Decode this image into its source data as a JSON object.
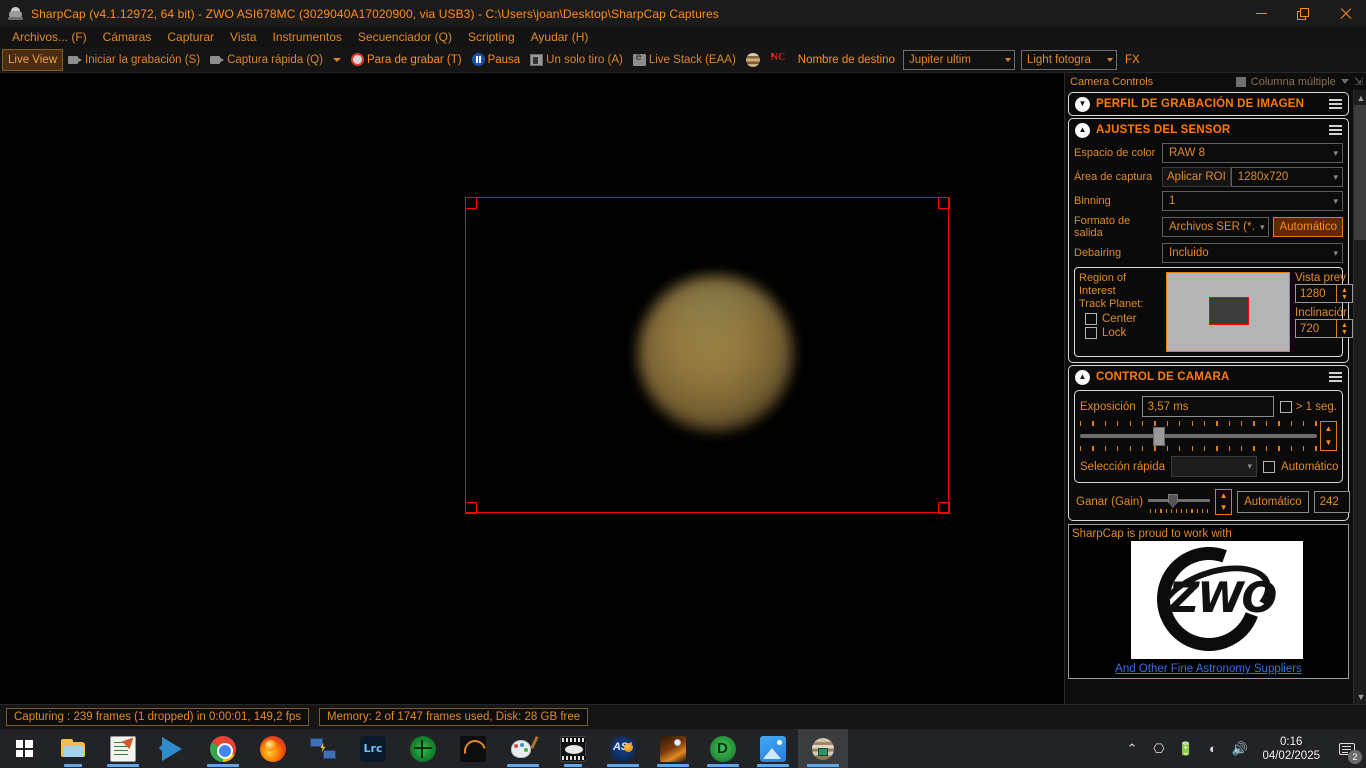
{
  "window": {
    "title": "SharpCap (v4.1.12972, 64 bit) - ZWO ASI678MC (3029040A17020900, via USB3) - C:\\Users\\joan\\Desktop\\SharpCap Captures",
    "minimize": "—",
    "maximize": "❐",
    "close": "✕"
  },
  "menu": {
    "items": [
      {
        "label": "Archivos... (F)"
      },
      {
        "label": "Cámaras"
      },
      {
        "label": "Capturar"
      },
      {
        "label": "Vista"
      },
      {
        "label": "Instrumentos"
      },
      {
        "label": "Secuenciador (Q)"
      },
      {
        "label": "Scripting"
      },
      {
        "label": "Ayudar (H)"
      }
    ]
  },
  "toolbar": {
    "live_view": "Live View",
    "start_recording": "Iniciar la grabación (S)",
    "quick_capture": "Captura rápida (Q)",
    "stop_recording": "Para de grabar (T)",
    "pause": "Pausa",
    "single_shot": "Un solo tiro (A)",
    "live_stack": "Live Stack (EAA)",
    "target_name_label": "Nombre de destino",
    "target_name_value": "Jupiter ultim",
    "light_frame_value": "Light fotogra",
    "fx": "FX"
  },
  "panel": {
    "header": {
      "title": "Camera Controls",
      "multi_column": "Columna múltiple",
      "pin": "⇲"
    },
    "capture_profile": {
      "title": "PERFIL DE GRABACIÓN DE IMAGEN",
      "collapsed": true
    },
    "sensor_settings": {
      "title": "AJUSTES DEL SENSOR",
      "rows": [
        {
          "label": "Espacio de color",
          "value": "RAW 8",
          "type": "combo"
        },
        {
          "label": "Área de captura",
          "button": "Aplicar ROI",
          "value": "1280x720",
          "type": "combo-button"
        },
        {
          "label": "Binning",
          "value": "1",
          "type": "combo"
        },
        {
          "label": "Formato de salida",
          "value": "Archivos SER (*…",
          "button": "Automático",
          "type": "combo-auto"
        },
        {
          "label": "Debairing",
          "value": "Incluido",
          "type": "combo"
        }
      ],
      "roi": {
        "title": "Region of Interest",
        "track_planet_label": "Track Planet:",
        "center_label": "Center",
        "center_checked": false,
        "lock_label": "Lock",
        "lock_checked": false,
        "preview_label": "Vista prev",
        "preview_value": "1280",
        "tilt_label": "Inclinaciór",
        "tilt_value": "720"
      }
    },
    "camera_control": {
      "title": "CONTROL DE CAMARA",
      "exposure_label": "Exposición",
      "exposure_value": "3,57 ms",
      "over_one_sec_label": "> 1 seg.",
      "over_one_sec_checked": false,
      "exposure_slider_percent": 31,
      "quick_select_label": "Selección rápida",
      "quick_select_value": "",
      "quick_auto_label": "Automático",
      "quick_auto_checked": false,
      "gain_label": "Ganar (Gain)",
      "gain_auto_label": "Automático",
      "gain_value": "242",
      "gain_slider_percent": 32
    },
    "sponsor": {
      "caption": "SharpCap is proud to work with",
      "logo_text": "ZWO",
      "link": "And Other Fine Astronomy Suppliers"
    }
  },
  "status": {
    "capture": "Capturing : 239 frames (1 dropped) in 0:00:01, 149,2 fps",
    "memory": "Memory: 2 of 1747 frames used, Disk: 28 GB free"
  },
  "taskbar": {
    "items": [
      {
        "name": "start",
        "icon": "windows-icon",
        "active": false
      },
      {
        "name": "file-explorer",
        "icon": "folder-icon",
        "active": false,
        "running": true
      },
      {
        "name": "notepad",
        "icon": "notepad-icon",
        "active": false,
        "running": true
      },
      {
        "name": "vs-code",
        "icon": "vscode-icon",
        "active": false,
        "running": false
      },
      {
        "name": "chrome",
        "icon": "chrome-icon",
        "active": false,
        "running": true
      },
      {
        "name": "firefox",
        "icon": "firefox-icon",
        "active": false,
        "running": false
      },
      {
        "name": "network-tool",
        "icon": "network-icon",
        "active": false,
        "running": false
      },
      {
        "name": "lightroom-classic",
        "icon": "lrc-icon",
        "active": false,
        "running": false
      },
      {
        "name": "pipp",
        "icon": "pipp-icon",
        "active": false,
        "running": false
      },
      {
        "name": "autostakkert",
        "icon": "autostakkert-icon",
        "active": false,
        "running": false
      },
      {
        "name": "paint",
        "icon": "paint-icon",
        "active": false,
        "running": true
      },
      {
        "name": "film-viewer",
        "icon": "film-icon",
        "active": false,
        "running": true
      },
      {
        "name": "as3",
        "icon": "as3-icon",
        "active": false,
        "running": true
      },
      {
        "name": "registax",
        "icon": "registax-icon",
        "active": false,
        "running": true
      },
      {
        "name": "davinci-resolve",
        "icon": "resolve-icon",
        "active": false,
        "running": true
      },
      {
        "name": "photos",
        "icon": "photos-icon",
        "active": false,
        "running": true
      },
      {
        "name": "sharpcap",
        "icon": "sharpcap-icon",
        "active": true,
        "running": true
      }
    ],
    "tray": {
      "show_hidden": "⌃",
      "camera_icon": "camera-icon",
      "battery_icon": "battery-icon",
      "wifi_icon": "wifi-icon",
      "volume_icon": "volume-icon",
      "time": "0:16",
      "date": "04/02/2025",
      "notification_count": "2"
    }
  }
}
